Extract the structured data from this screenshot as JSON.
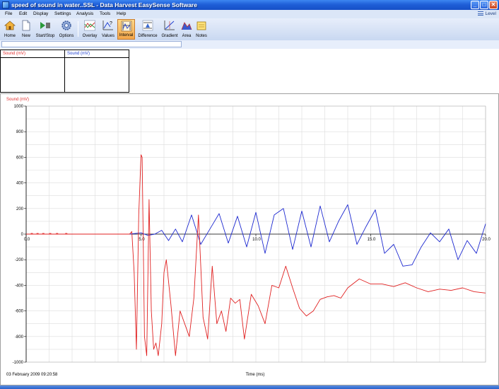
{
  "window": {
    "title": "speed of sound in water..SSL - Data Harvest EasySense Software",
    "minimize_label": "_",
    "maximize_label": "□",
    "close_label": "✕"
  },
  "menu": {
    "items": [
      "File",
      "Edit",
      "Display",
      "Settings",
      "Analysis",
      "Tools",
      "Help"
    ],
    "level_label": "Level"
  },
  "toolbar": {
    "home": "Home",
    "new": "New",
    "startstop": "Start/Stop",
    "options": "Options",
    "overlay": "Overlay",
    "values": "Values",
    "interval": "Interval",
    "difference": "Difference",
    "gradient": "Gradient",
    "area": "Area",
    "notes": "Notes"
  },
  "panels": [
    {
      "label": "Sound (mV)",
      "color": "#e03030"
    },
    {
      "label": "Sound (mV)",
      "color": "#2040d0"
    }
  ],
  "graph": {
    "y_axis_label": "Sound (mV)",
    "timestamp": "03 February 2009  09:20:58",
    "colors": {
      "red": "#e02020",
      "blue": "#1c28d0",
      "grid": "#dcdcdc"
    }
  },
  "chart_data": {
    "type": "line",
    "ylabel": "Sound (mV)",
    "xlabel": "Time (ms)",
    "xlim": [
      0,
      20
    ],
    "ylim": [
      -1000,
      1000
    ],
    "x_ticks": [
      "0.0",
      "5.0",
      "10.0",
      "15.0",
      "20.0"
    ],
    "y_ticks": [
      "1000",
      "800",
      "600",
      "400",
      "200",
      "0",
      "-200",
      "-400",
      "-600",
      "-800",
      "-1000"
    ],
    "grid": true,
    "series": [
      {
        "color": "#e02020",
        "x": [
          0,
          4.5,
          4.6,
          4.7,
          4.8,
          4.9,
          5.0,
          5.05,
          5.15,
          5.25,
          5.35,
          5.45,
          5.55,
          5.65,
          5.75,
          5.9,
          6.0,
          6.1,
          6.3,
          6.5,
          6.7,
          6.9,
          7.1,
          7.3,
          7.5,
          7.7,
          7.9,
          8.1,
          8.3,
          8.5,
          8.7,
          8.9,
          9.1,
          9.3,
          9.5,
          9.8,
          10.1,
          10.4,
          10.7,
          11.0,
          11.3,
          11.6,
          11.9,
          12.2,
          12.5,
          12.8,
          13.1,
          13.4,
          13.7,
          14.0,
          14.5,
          15.0,
          15.5,
          16.0,
          16.5,
          17.0,
          17.5,
          18.0,
          18.5,
          19.0,
          19.5,
          20.0
        ],
        "y": [
          0,
          0,
          20,
          -300,
          -900,
          150,
          620,
          600,
          -800,
          -950,
          270,
          -600,
          -900,
          -850,
          -950,
          -700,
          -300,
          -200,
          -550,
          -950,
          -600,
          -700,
          -800,
          -500,
          150,
          -650,
          -820,
          -250,
          -700,
          -600,
          -760,
          -500,
          -540,
          -510,
          -820,
          -470,
          -560,
          -700,
          -400,
          -420,
          -250,
          -420,
          -580,
          -640,
          -600,
          -510,
          -490,
          -480,
          -500,
          -420,
          -350,
          -390,
          -390,
          -410,
          -380,
          -420,
          -450,
          -430,
          -440,
          -420,
          -450,
          -460
        ]
      },
      {
        "color": "#1c28d0",
        "x": [
          0,
          4.5,
          5.0,
          5.3,
          5.6,
          5.9,
          6.2,
          6.5,
          6.8,
          7.2,
          7.6,
          8.0,
          8.4,
          8.8,
          9.2,
          9.6,
          10.0,
          10.4,
          10.8,
          11.2,
          11.6,
          12.0,
          12.4,
          12.8,
          13.2,
          13.6,
          14.0,
          14.4,
          14.8,
          15.2,
          15.6,
          16.0,
          16.4,
          16.8,
          17.2,
          17.6,
          18.0,
          18.4,
          18.8,
          19.2,
          19.6,
          20.0
        ],
        "y": [
          0,
          0,
          10,
          -10,
          0,
          30,
          -50,
          40,
          -60,
          150,
          -80,
          40,
          160,
          -70,
          140,
          -100,
          170,
          -150,
          150,
          200,
          -120,
          180,
          -100,
          220,
          -60,
          100,
          230,
          -80,
          60,
          190,
          -150,
          -80,
          -250,
          -240,
          -100,
          10,
          -60,
          40,
          -200,
          -50,
          -150,
          80
        ]
      }
    ]
  }
}
